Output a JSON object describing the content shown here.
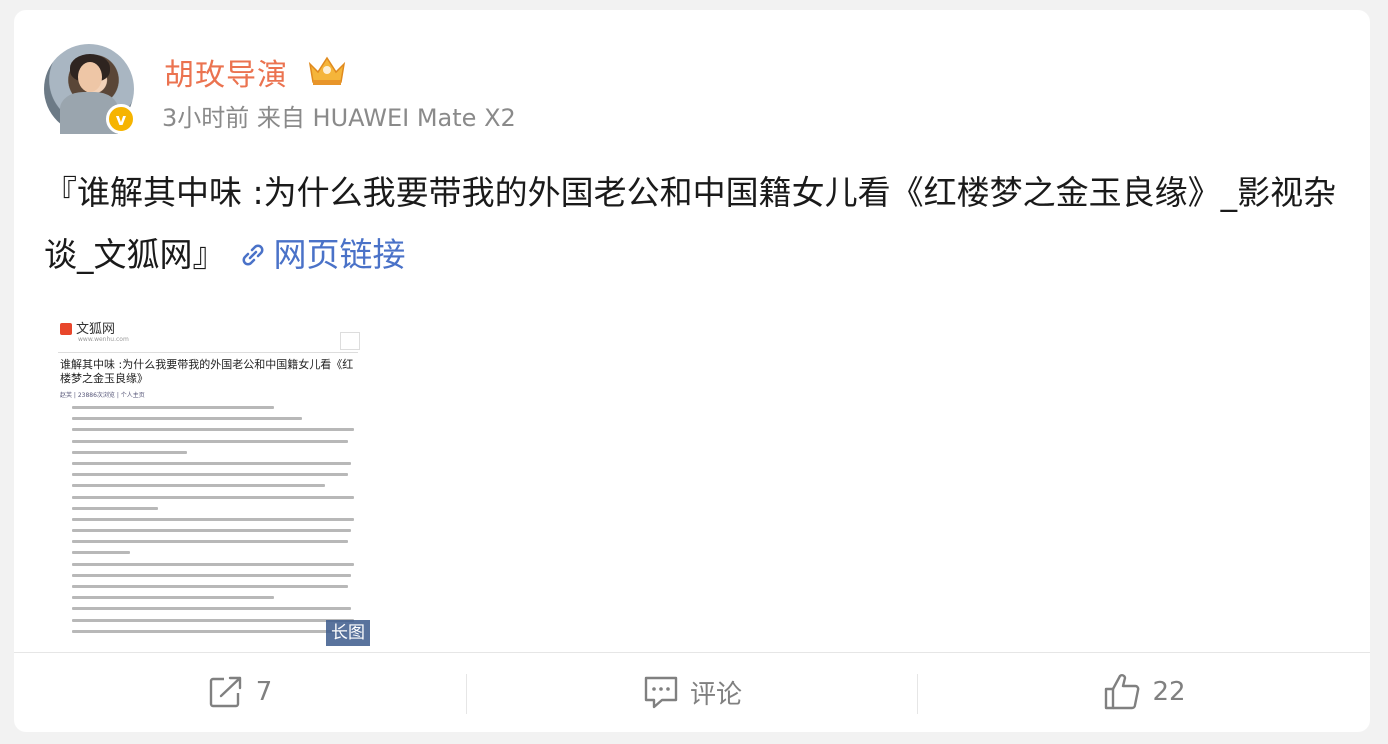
{
  "user": {
    "name": "胡玫导演",
    "meta": "3小时前 来自 HUAWEI Mate X2",
    "verified_icon": "verified-badge-icon"
  },
  "post": {
    "text": "『谁解其中味 :为什么我要带我的外国老公和中国籍女儿看《红楼梦之金玉良缘》_影视杂谈_文狐网』",
    "link_label": "网页链接"
  },
  "preview": {
    "site_name": "文狐网",
    "site_url": "www.wenhu.com",
    "article_title": "谁解其中味 :为什么我要带我的外国老公和中国籍女儿看《红楼梦之金玉良缘》",
    "byline": "赵芙 | 23886次浏览 | 个人主页",
    "badge": "长图"
  },
  "actions": {
    "repost_count": "7",
    "comment_label": "评论",
    "like_count": "22"
  },
  "colors": {
    "username": "#eb7350",
    "link": "#4a72c8",
    "meta": "#8a8a8a"
  }
}
